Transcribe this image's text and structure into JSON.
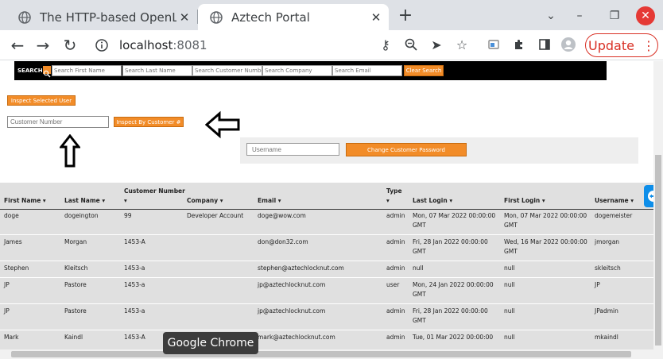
{
  "browser": {
    "tabs": [
      {
        "title": "The HTTP-based OpenLin",
        "active": false
      },
      {
        "title": "Aztech Portal",
        "active": true
      }
    ],
    "url_host": "localhost",
    "url_port": ":8081",
    "update_label": "Update",
    "tooltip": "Google Chrome"
  },
  "search": {
    "label": "SEARCH",
    "first_name_placeholder": "Search First Name",
    "last_name_placeholder": "Search Last Name",
    "customer_number_placeholder": "Search Customer Number",
    "company_placeholder": "Search Company",
    "email_placeholder": "Search Email",
    "clear_label": "Clear Search"
  },
  "actions": {
    "inspect_selected_label": "Inspect Selected User",
    "customer_number_placeholder": "Customer Number",
    "inspect_by_customer_label": "Inspect By Customer #",
    "username_placeholder": "Username",
    "change_password_label": "Change Customer Password"
  },
  "table": {
    "columns": [
      {
        "line1": "",
        "line2": "First Name ▾"
      },
      {
        "line1": "",
        "line2": "Last Name ▾"
      },
      {
        "line1": "Customer Number",
        "line2": "▾"
      },
      {
        "line1": "",
        "line2": "Company ▾"
      },
      {
        "line1": "",
        "line2": "Email ▾"
      },
      {
        "line1": "Type",
        "line2": "▾"
      },
      {
        "line1": "",
        "line2": "Last Login ▾"
      },
      {
        "line1": "",
        "line2": "First Login ▾"
      },
      {
        "line1": "",
        "line2": "Username ▾"
      }
    ],
    "rows": [
      {
        "first": "doge",
        "last": "dogeington",
        "cust": "99",
        "company": "Developer Account",
        "email": "doge@wow.com",
        "type": "admin",
        "last_login": [
          "Mon, 07 Mar 2022 00:00:00",
          "GMT"
        ],
        "first_login": [
          "Mon, 07 Mar 2022 00:00:00",
          "GMT"
        ],
        "username": "dogemeister"
      },
      {
        "first": "James",
        "last": "Morgan",
        "cust": "1453-A",
        "company": "",
        "email": "don@don32.com",
        "type": "admin",
        "last_login": [
          "Fri, 28 Jan 2022 00:00:00",
          "GMT"
        ],
        "first_login": [
          "Wed, 16 Mar 2022 00:00:00",
          "GMT"
        ],
        "username": "jmorgan"
      },
      {
        "first": "Stephen",
        "last": "Kleitsch",
        "cust": "1453-a",
        "company": "",
        "email": "stephen@aztechlocknut.com",
        "type": "admin",
        "last_login": [
          "null",
          ""
        ],
        "first_login": [
          "null",
          ""
        ],
        "username": "skleitsch"
      },
      {
        "first": "JP",
        "last": "Pastore",
        "cust": "1453-a",
        "company": "",
        "email": "jp@aztechlocknut.com",
        "type": "user",
        "last_login": [
          "Mon, 24 Jan 2022 00:00:00",
          "GMT"
        ],
        "first_login": [
          "null",
          ""
        ],
        "username": "JP"
      },
      {
        "first": "JP",
        "last": "Pastore",
        "cust": "1453-a",
        "company": "",
        "email": "jp@aztechlocknut.com",
        "type": "admin",
        "last_login": [
          "Fri, 28 Jan 2022 00:00:00",
          "GMT"
        ],
        "first_login": [
          "null",
          ""
        ],
        "username": "JPadmin"
      },
      {
        "first": "Mark",
        "last": "Kaindl",
        "cust": "1453-A",
        "company": "",
        "email": "mark@aztechlocknut.com",
        "type": "admin",
        "last_login": [
          "Tue, 01 Mar 2022 00:00:00",
          ""
        ],
        "first_login": [
          "null",
          ""
        ],
        "username": "mkaindl"
      }
    ]
  },
  "colors": {
    "accent": "#f28c28",
    "table_bg": "#e0e0e0",
    "update_red": "#d93025"
  }
}
